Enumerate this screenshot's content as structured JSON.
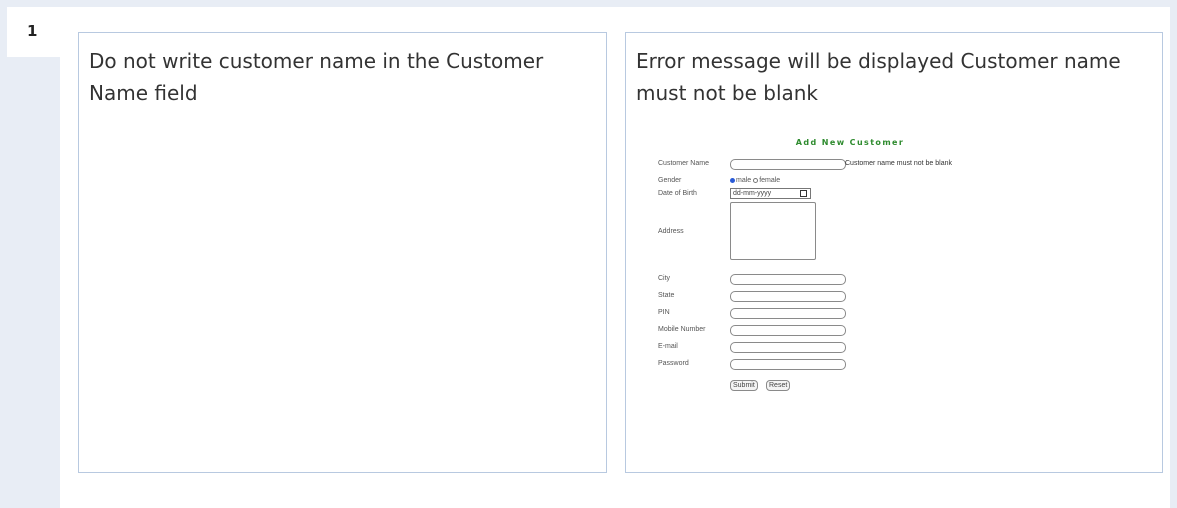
{
  "row": {
    "number": "1"
  },
  "steps": {
    "step_text": "Do not write customer name in the Customer Name field",
    "expected_text": "Error message will be displayed Customer name must not be blank"
  },
  "form": {
    "title": "Add New Customer",
    "labels": {
      "customer_name": "Customer Name",
      "gender": "Gender",
      "dob": "Date of Birth",
      "address": "Address",
      "city": "City",
      "state": "State",
      "pin": "PIN",
      "mobile": "Mobile Number",
      "email": "E-mail",
      "password": "Password"
    },
    "error_message": "Customer name must not be blank",
    "gender_male": "male",
    "gender_female": "female",
    "dob_placeholder": "dd-mm-yyyy",
    "submit_label": "Submit",
    "reset_label": "Reset"
  },
  "colors": {
    "background": "#e8edf5",
    "cell_border": "#b8c9e0",
    "form_title": "#2e8b2e",
    "radio_selected": "#2a5bd7"
  }
}
